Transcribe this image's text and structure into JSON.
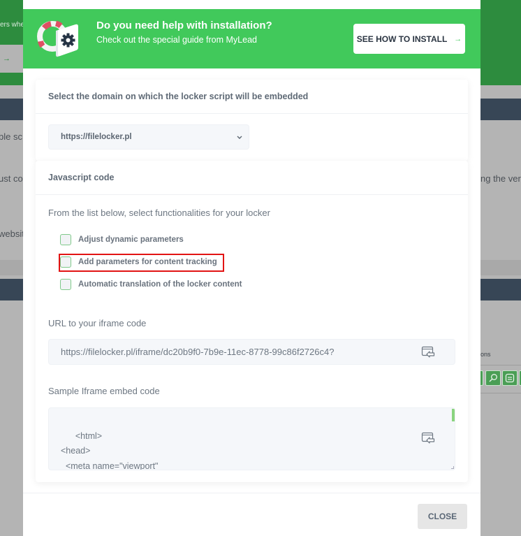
{
  "background": {
    "left_text_top": "ers whe",
    "left_button_arrow": "→",
    "left_texts": [
      "ble sc",
      "ust co",
      "websit"
    ],
    "right_text": "ng the ver",
    "right_small": "ons"
  },
  "banner": {
    "title": "Do you need help with installation?",
    "subtitle": "Check out the special guide from MyLead",
    "button_label": "SEE HOW TO INSTALL",
    "button_arrow": "→"
  },
  "domain_card": {
    "title": "Select the domain on which the locker script will be embedded",
    "selected_domain": "https://filelocker.pl"
  },
  "js_card": {
    "title": "Javascript code",
    "intro": "From the list below, select functionalities for your locker",
    "options": [
      {
        "label": "Adjust dynamic parameters",
        "checked": false
      },
      {
        "label": "Add parameters for content tracking",
        "checked": false,
        "highlighted": true
      },
      {
        "label": "Automatic translation of the locker content",
        "checked": false
      }
    ],
    "url_label": "URL to your iframe code",
    "url_value": "https://filelocker.pl/iframe/dc20b9f0-7b9e-11ec-8778-99c86f2726c4?",
    "embed_label": "Sample Iframe embed code",
    "embed_code": "<html>\n<head>\n  <meta name=\"viewport\"\n        content=\"width=device-width, user-scalable=no, initial-scale=1.0, maximum-"
  },
  "footer": {
    "close_label": "CLOSE"
  },
  "colors": {
    "brand_green": "#41c95b",
    "highlight_red": "#e21414"
  }
}
